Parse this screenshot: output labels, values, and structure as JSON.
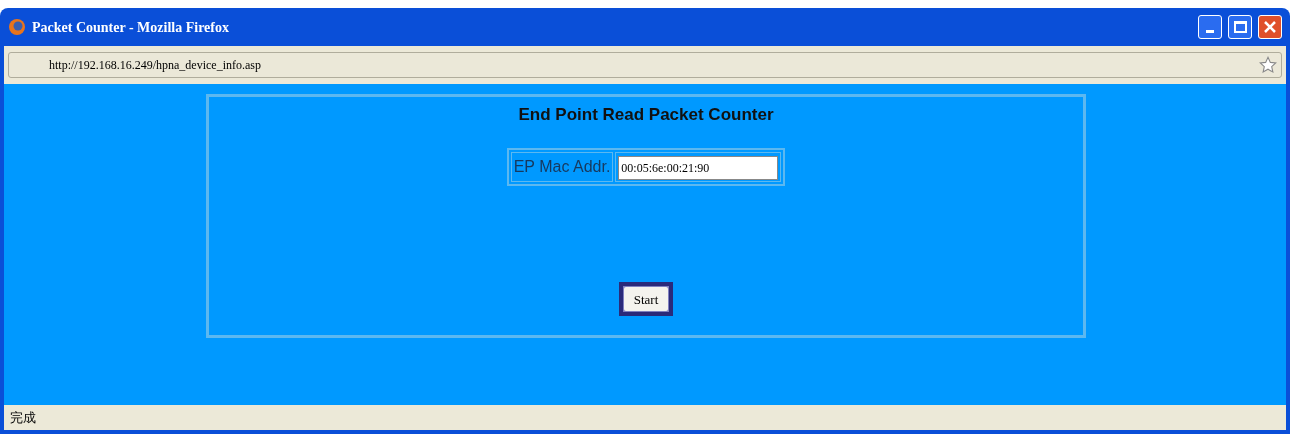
{
  "window": {
    "title": "Packet Counter - Mozilla Firefox"
  },
  "address_bar": {
    "url": "http://192.168.16.249/hpna_device_info.asp"
  },
  "panel": {
    "title": "End Point Read Packet Counter",
    "field_label": "EP Mac Addr.",
    "field_value": "00:05:6e:00:21:90",
    "button": "Start"
  },
  "status_bar": {
    "text": "完成"
  }
}
